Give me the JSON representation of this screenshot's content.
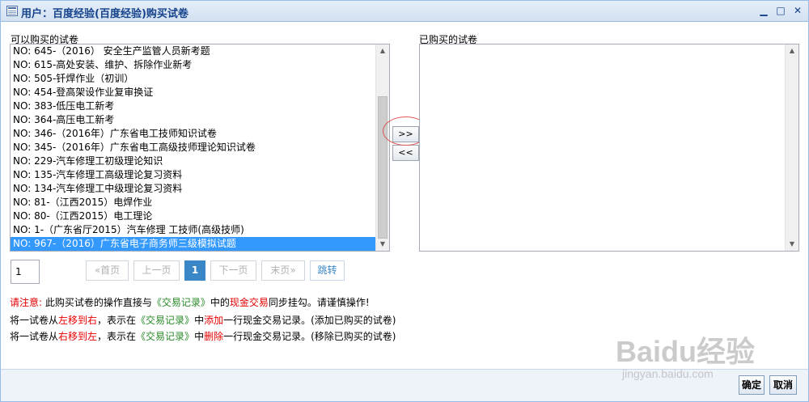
{
  "window": {
    "title": "用户：百度经验(百度经验)购买试卷",
    "minimize": "▁",
    "maximize": "□",
    "close": "✕"
  },
  "available": {
    "label": "可以购买的试卷",
    "items": [
      "NO: 645-（2016） 安全生产监管人员新考题",
      "NO: 615-高处安装、维护、拆除作业新考",
      "NO: 505-钎焊作业（初训）",
      "NO: 454-登高架设作业复审换证",
      "NO: 383-低压电工新考",
      "NO: 364-高压电工新考",
      "NO: 346-（2016年）广东省电工技师知识试卷",
      "NO: 345-（2016年）广东省电工高级技师理论知识试卷",
      "NO: 229-汽车修理工初级理论知识",
      "NO: 135-汽车修理工高级理论复习资料",
      "NO: 134-汽车修理工中级理论复习资料",
      "NO: 81-（江西2015）电焊作业",
      "NO: 80-（江西2015）电工理论",
      "NO: 1-（广东省厅2015）汽车修理 工技师(高级技师)",
      "NO: 967-（2016）广东省电子商务师三级模拟试题"
    ],
    "selected_index": 14
  },
  "purchased": {
    "label": "已购买的试卷",
    "items": []
  },
  "move": {
    "add": ">>",
    "remove": "<<"
  },
  "pager": {
    "page_value": "1",
    "first": "«首页",
    "prev": "上一页",
    "current": "1",
    "next": "下一页",
    "last": "末页»",
    "jump": "跳转"
  },
  "notice": {
    "line1": {
      "p1": "请注意:",
      "p2": "  此购买试卷的操作直接与",
      "p3": "《交易记录》",
      "p4": "中的",
      "p5": "现金交易",
      "p6": "同步挂勾。请谨慎操作!"
    },
    "line2": {
      "p1": "将一试卷从",
      "p2": "左移到右",
      "p3": "，表示在",
      "p4": "《交易记录》",
      "p5": "中",
      "p6": "添加",
      "p7": "一行现金交易记录。(添加已购买的试卷)"
    },
    "line3": {
      "p1": "将一试卷从",
      "p2": "右移到左",
      "p3": "，表示在",
      "p4": "《交易记录》",
      "p5": "中",
      "p6": "删除",
      "p7": "一行现金交易记录。(移除已购买的试卷)"
    }
  },
  "footer": {
    "confirm": "确定",
    "cancel": "取消"
  },
  "watermark": {
    "logo": "Baidu经验",
    "url": "jingyan.baidu.com"
  },
  "colors": {
    "selection": "#3399ff",
    "warning_red": "#e60000",
    "link_green": "#2a8a2a",
    "pager_active": "#3a87c8",
    "title_blue": "#15428b"
  }
}
